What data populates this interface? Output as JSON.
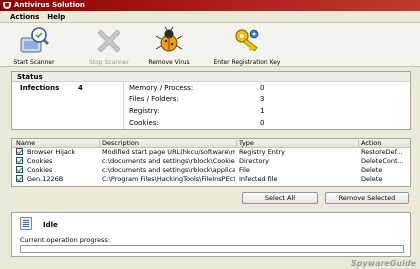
{
  "window": {
    "title": "Antivirus Solution"
  },
  "menu": [
    "Actions",
    "Help"
  ],
  "toolbar": {
    "start_scanner": "Start Scanner",
    "stop_scanner": "Stop Scanner",
    "remove_virus": "Remove Virus",
    "enter_key": "Enter Registration Key"
  },
  "status": {
    "title": "Status",
    "infections_label": "Infections",
    "infections_value": "4",
    "rows": [
      {
        "label": "Memory / Process:",
        "value": "0"
      },
      {
        "label": "Files / Folders:",
        "value": "3"
      },
      {
        "label": "Registry:",
        "value": "1"
      },
      {
        "label": "Cookies:",
        "value": "0"
      }
    ]
  },
  "threats": {
    "columns": [
      "Name",
      "Description",
      "Type",
      "Action"
    ],
    "rows": [
      {
        "name": "Browser Hijack",
        "description": "Modified start page URL(hkcu/software\\micr...",
        "type": "Registry Entry",
        "action": "RestoreDef..."
      },
      {
        "name": "Cookies",
        "description": "c:\\documents and settings\\rblock\\Cookies",
        "type": "Directory",
        "action": "DeleteCont..."
      },
      {
        "name": "Cookies",
        "description": "c:\\documents and settings\\rblock\\applicatio...",
        "type": "File",
        "action": "Delete"
      },
      {
        "name": "Gen.1226B",
        "description": "C:\\Program Files\\HackingTools\\FileInsPEctor ...",
        "type": "Infected file",
        "action": "Delete"
      }
    ]
  },
  "buttons": {
    "select_all": "Select All",
    "remove_selected": "Remove Selected"
  },
  "operation": {
    "state": "Idle",
    "progress_label": "Current operation progress:",
    "progress": 0
  },
  "watermark": "SpywareGuide",
  "colors": {
    "title_bar": "#b22222",
    "window_bg": "#ece9d8",
    "check_green": "#21a121"
  }
}
